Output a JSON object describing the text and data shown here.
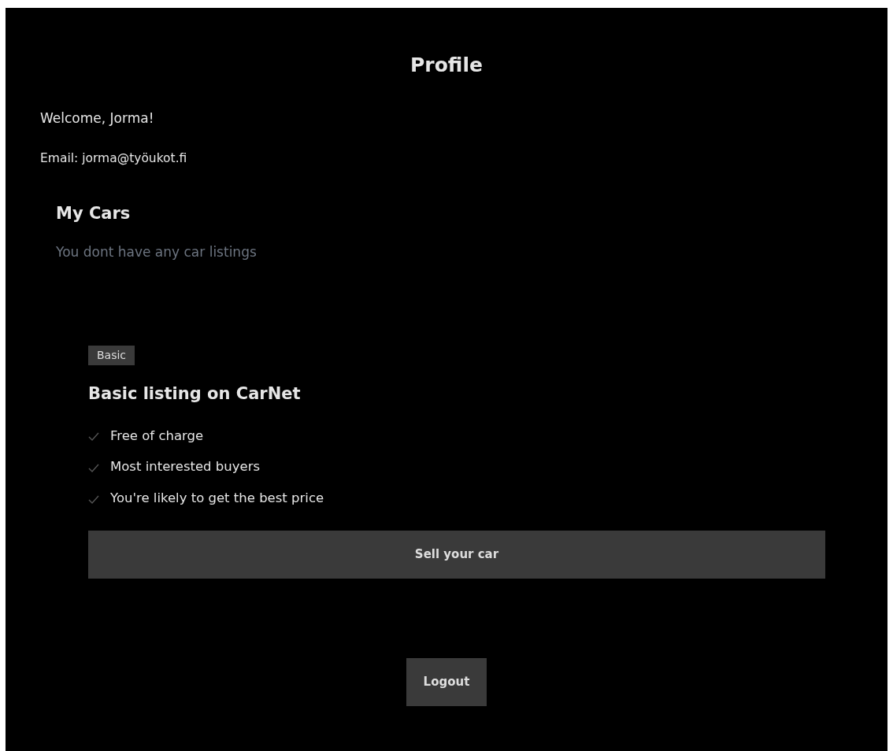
{
  "page": {
    "title": "Profile"
  },
  "user": {
    "welcome": "Welcome, Jorma!",
    "email": "Email: jorma@työukot.fi"
  },
  "my_cars": {
    "heading": "My Cars",
    "empty_message": "You dont have any car listings"
  },
  "plan": {
    "badge": "Basic",
    "title": "Basic listing on CarNet",
    "features": [
      {
        "label": "Free of charge",
        "checked": true
      },
      {
        "label": "Most interested buyers",
        "checked": true
      },
      {
        "label": "You're likely to get the best price",
        "checked": true
      }
    ],
    "button": "Sell your car"
  },
  "logout_button": "Logout"
}
